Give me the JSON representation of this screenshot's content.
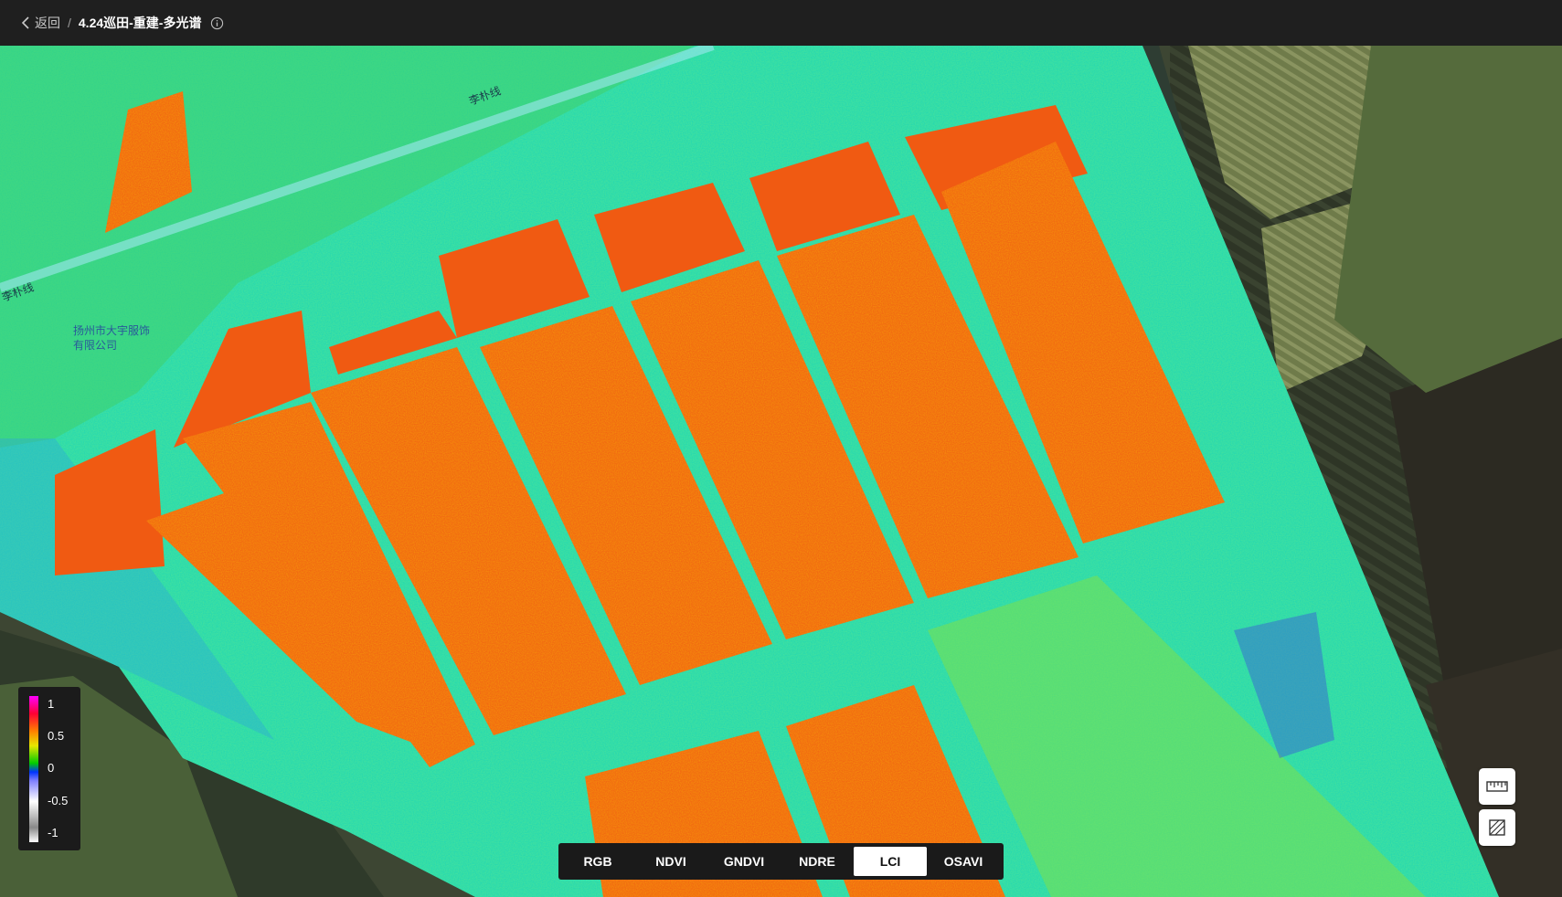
{
  "header": {
    "back_label": "返回",
    "separator": "/",
    "title": "4.24巡田-重建-多光谱"
  },
  "map": {
    "road_label_top": "李朴线",
    "road_label_left": "李朴线",
    "poi_label_line1": "扬州市大宇服饰",
    "poi_label_line2": "有限公司"
  },
  "legend": {
    "ticks": [
      "1",
      "0.5",
      "0",
      "-0.5",
      "-1"
    ]
  },
  "tools": [
    {
      "name": "ruler-icon"
    },
    {
      "name": "area-measure-icon"
    }
  ],
  "bands": {
    "items": [
      "RGB",
      "NDVI",
      "GNDVI",
      "NDRE",
      "LCI",
      "OSAVI"
    ],
    "selected": "LCI"
  },
  "colors": {
    "field_high": "#f05a12",
    "field_mid": "#22dba8",
    "background": "#1f1f1f"
  }
}
